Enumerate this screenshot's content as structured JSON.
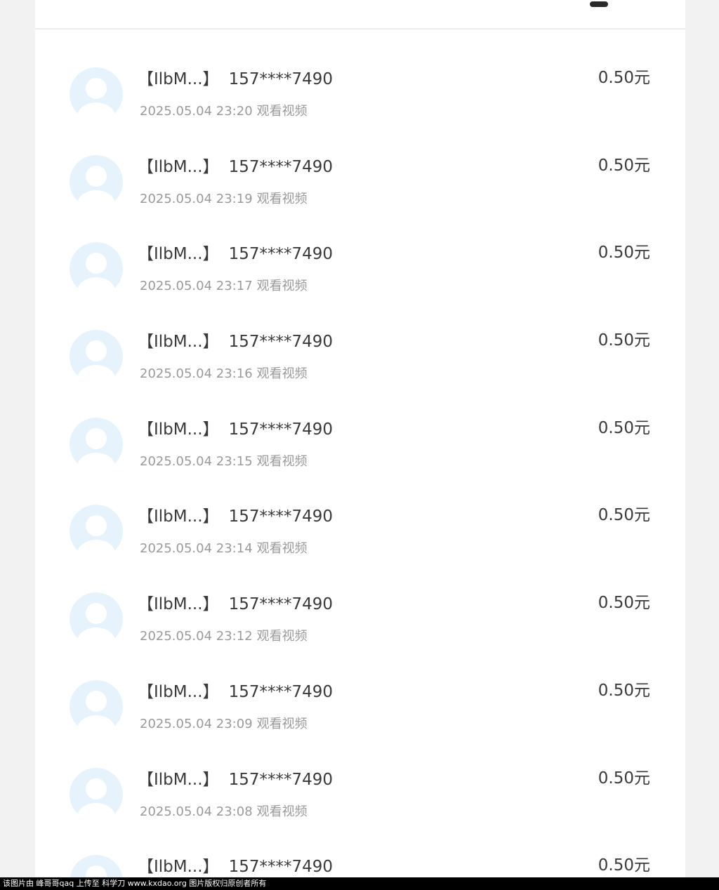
{
  "records": [
    {
      "name": "【IlbM...】",
      "phone": "157****7490",
      "time": "2025.05.04 23:20",
      "action": "观看视频",
      "amount": "0.50元"
    },
    {
      "name": "【IlbM...】",
      "phone": "157****7490",
      "time": "2025.05.04 23:19",
      "action": "观看视频",
      "amount": "0.50元"
    },
    {
      "name": "【IlbM...】",
      "phone": "157****7490",
      "time": "2025.05.04 23:17",
      "action": "观看视频",
      "amount": "0.50元"
    },
    {
      "name": "【IlbM...】",
      "phone": "157****7490",
      "time": "2025.05.04 23:16",
      "action": "观看视频",
      "amount": "0.50元"
    },
    {
      "name": "【IlbM...】",
      "phone": "157****7490",
      "time": "2025.05.04 23:15",
      "action": "观看视频",
      "amount": "0.50元"
    },
    {
      "name": "【IlbM...】",
      "phone": "157****7490",
      "time": "2025.05.04 23:14",
      "action": "观看视频",
      "amount": "0.50元"
    },
    {
      "name": "【IlbM...】",
      "phone": "157****7490",
      "time": "2025.05.04 23:12",
      "action": "观看视频",
      "amount": "0.50元"
    },
    {
      "name": "【IlbM...】",
      "phone": "157****7490",
      "time": "2025.05.04 23:09",
      "action": "观看视频",
      "amount": "0.50元"
    },
    {
      "name": "【IlbM...】",
      "phone": "157****7490",
      "time": "2025.05.04 23:08",
      "action": "观看视频",
      "amount": "0.50元"
    },
    {
      "name": "【IlbM...】",
      "phone": "157****7490",
      "time": "",
      "action": "",
      "amount": "0.50元"
    }
  ],
  "watermark": "该图片由 峰哥哥qaq 上传至 科学刀 www.kxdao.org 图片版权归原创者所有",
  "colors": {
    "page_background": "#f2f2f2",
    "panel_background": "#ffffff",
    "primary_text": "#3a3a3a",
    "secondary_text": "#9a9a9a",
    "avatar_background": "#e6f3fc"
  }
}
